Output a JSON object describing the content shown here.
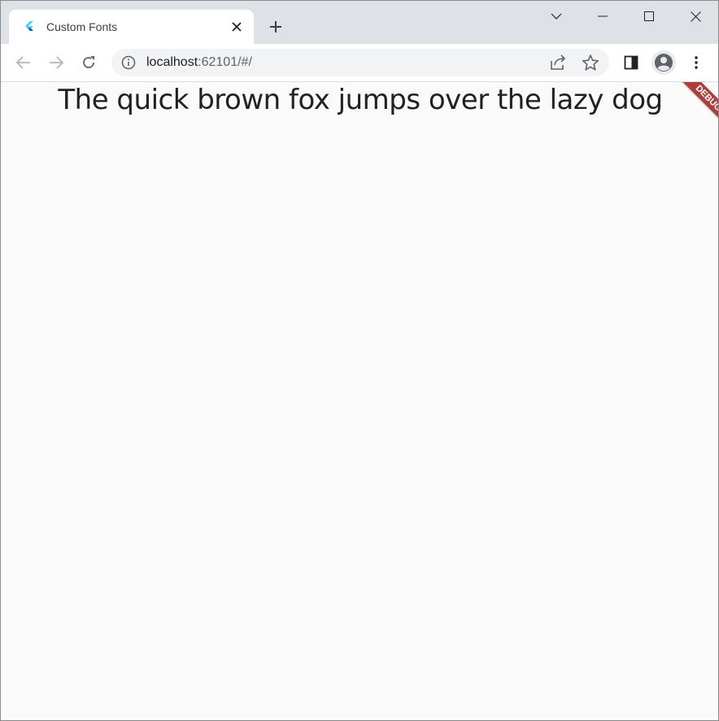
{
  "tab": {
    "title": "Custom Fonts",
    "favicon": "flutter-logo-icon"
  },
  "window_controls": {
    "tab_search": "chevron-down-icon",
    "minimize": "minimize-icon",
    "maximize": "maximize-icon",
    "close": "close-icon"
  },
  "toolbar": {
    "url_host": "localhost",
    "url_rest": ":62101/#/",
    "icons": [
      "back-arrow-icon",
      "forward-arrow-icon",
      "reload-icon",
      "info-icon",
      "share-icon",
      "star-icon",
      "side-panel-icon",
      "profile-icon",
      "menu-icon"
    ]
  },
  "content": {
    "headline": "The quick brown fox jumps over the lazy dog",
    "debug_banner": "DEBUG"
  },
  "colors": {
    "tabstrip": "#dee1e6",
    "debug_banner": "#a52a2a",
    "page_background": "#fafafa"
  }
}
